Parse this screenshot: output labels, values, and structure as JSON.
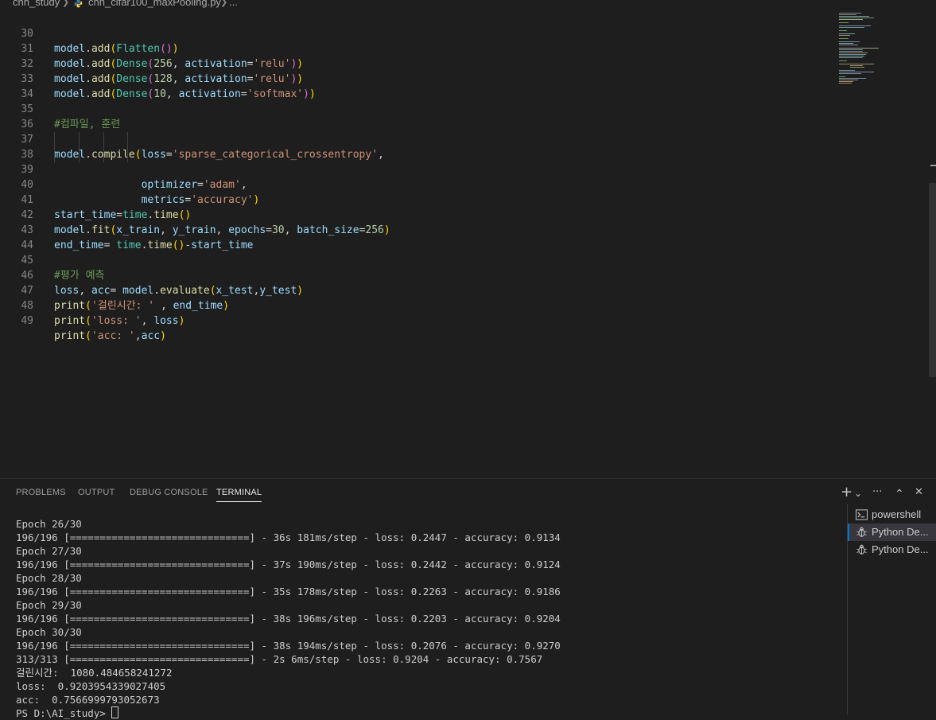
{
  "breadcrumb": {
    "folder": "cnn_study",
    "file": "cnn_cifar100_maxPooling.py",
    "more": "..."
  },
  "editor": {
    "lines": [
      {
        "n": "30",
        "code": "model.add(Flatten())"
      },
      {
        "n": "31",
        "code": "model.add(Dense(256, activation='relu'))"
      },
      {
        "n": "32",
        "code": "model.add(Dense(128, activation='relu'))"
      },
      {
        "n": "33",
        "code": "model.add(Dense(10, activation='softmax'))"
      },
      {
        "n": "34",
        "code": ""
      },
      {
        "n": "35",
        "code": "#컴파일, 훈련"
      },
      {
        "n": "36",
        "code": ""
      },
      {
        "n": "37",
        "code": "model.compile(loss='sparse_categorical_crossentropy',"
      },
      {
        "n": "38",
        "code": "              optimizer='adam',"
      },
      {
        "n": "39",
        "code": "              metrics='accuracy')"
      },
      {
        "n": "40",
        "code": ""
      },
      {
        "n": "41",
        "code": "start_time=time.time()"
      },
      {
        "n": "42",
        "code": "model.fit(x_train, y_train, epochs=30, batch_size=256)"
      },
      {
        "n": "43",
        "code": "end_time= time.time()-start_time"
      },
      {
        "n": "44",
        "code": ""
      },
      {
        "n": "45",
        "code": "#평가 예측"
      },
      {
        "n": "46",
        "code": "loss, acc= model.evaluate(x_test,y_test)"
      },
      {
        "n": "47",
        "code": "print('걸린시간: ' , end_time)"
      },
      {
        "n": "48",
        "code": "print('loss: ', loss)"
      },
      {
        "n": "49",
        "code": "print('acc: ',acc)"
      }
    ]
  },
  "panel": {
    "tabs": [
      "PROBLEMS",
      "OUTPUT",
      "DEBUG CONSOLE",
      "TERMINAL"
    ],
    "active_tab": "TERMINAL",
    "actions": {
      "add": "+",
      "dropdown": "⌄",
      "more": "···",
      "maximize": "⌃",
      "close": "✕"
    }
  },
  "terminal": {
    "lines": [
      "Epoch 26/30",
      "196/196 [==============================] - 36s 181ms/step - loss: 0.2447 - accuracy: 0.9134",
      "Epoch 27/30",
      "196/196 [==============================] - 37s 190ms/step - loss: 0.2442 - accuracy: 0.9124",
      "Epoch 28/30",
      "196/196 [==============================] - 35s 178ms/step - loss: 0.2263 - accuracy: 0.9186",
      "Epoch 29/30",
      "196/196 [==============================] - 38s 196ms/step - loss: 0.2203 - accuracy: 0.9204",
      "Epoch 30/30",
      "196/196 [==============================] - 38s 194ms/step - loss: 0.2076 - accuracy: 0.9270",
      "313/313 [==============================] - 2s 6ms/step - loss: 0.9204 - accuracy: 0.7567",
      "걸린시간:  1080.484658241272",
      "loss:  0.9203954339027405",
      "acc:  0.7566999793052673"
    ],
    "prompt": "PS D:\\AI_study> "
  },
  "terminal_list": [
    {
      "label": "powershell",
      "icon": "terminal-icon",
      "selected": false
    },
    {
      "label": "Python De...",
      "icon": "debug-icon",
      "selected": true
    },
    {
      "label": "Python De...",
      "icon": "debug-icon",
      "selected": false
    }
  ]
}
